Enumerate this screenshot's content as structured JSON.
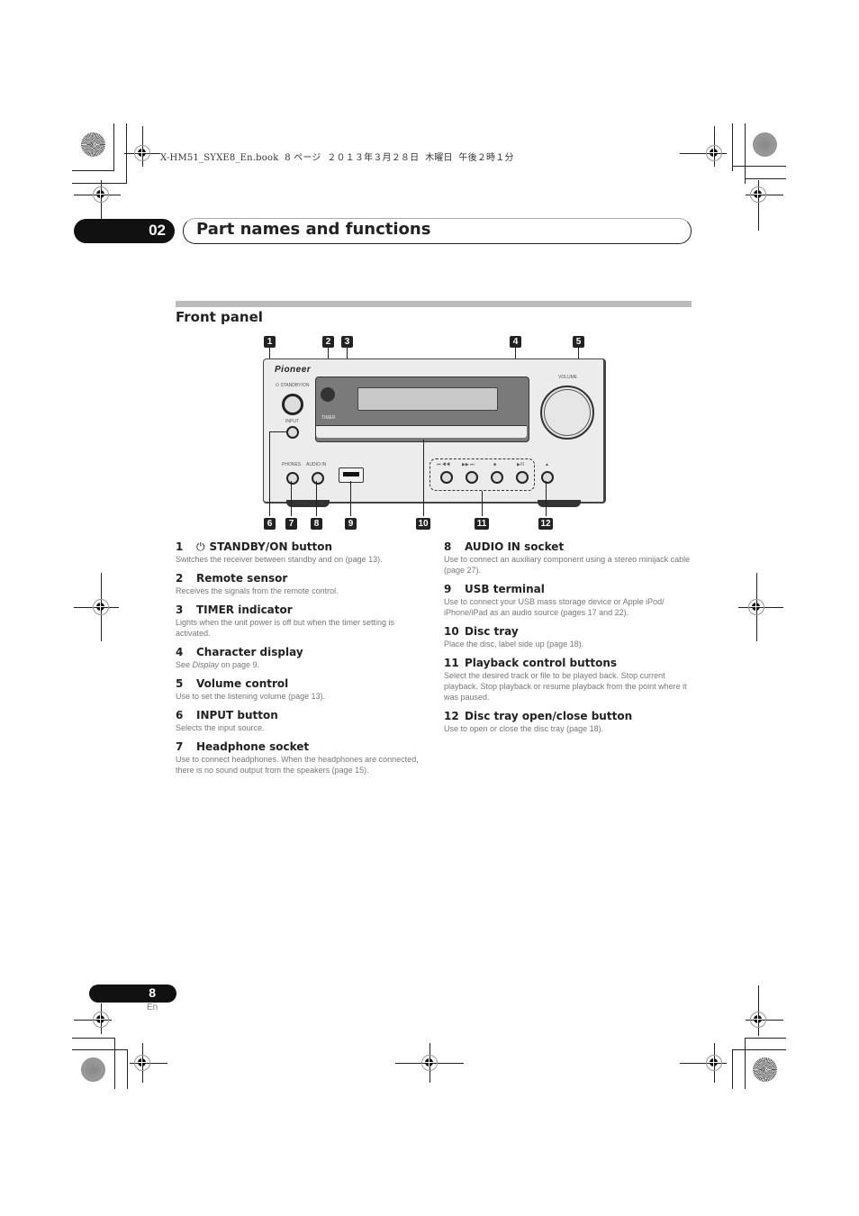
{
  "print_info": "X-HM51_SYXE8_En.book  8 ページ  ２０１３年３月２８日  木曜日  午後２時１分",
  "chapter": {
    "number": "02",
    "title": "Part names and functions"
  },
  "section": {
    "title": "Front panel"
  },
  "diagram": {
    "brand": "Pioneer",
    "labels": {
      "standby": "⏻ STANDBY/ON",
      "timer": "TIMER",
      "input": "INPUT",
      "volume": "VOLUME",
      "phones": "PHONES",
      "audio_in": "AUDIO IN",
      "prev": "⏮ ◀◀",
      "next": "▶▶ ⏭",
      "stop": "■",
      "play_pause": "▶/II",
      "eject": "▲"
    },
    "callouts": [
      "1",
      "2",
      "3",
      "4",
      "5",
      "6",
      "7",
      "8",
      "9",
      "10",
      "11",
      "12"
    ]
  },
  "items_left": [
    {
      "num": "1",
      "icon": "power-icon",
      "icon_glyph": "⏻",
      "title": "STANDBY/ON button",
      "desc": "Switches the receiver between standby and on (page 13)."
    },
    {
      "num": "2",
      "title": "Remote sensor",
      "desc": "Receives the signals from the remote control."
    },
    {
      "num": "3",
      "title": "TIMER indicator",
      "desc": "Lights when the unit power is off but when the timer setting is activated."
    },
    {
      "num": "4",
      "title": "Character display",
      "desc_prefix": "See ",
      "desc_em": "Display",
      "desc_suffix": " on page 9."
    },
    {
      "num": "5",
      "title": "Volume control",
      "desc": "Use to set the listening volume (page 13)."
    },
    {
      "num": "6",
      "title": "INPUT button",
      "desc": "Selects the input source."
    },
    {
      "num": "7",
      "title": "Headphone socket",
      "desc": "Use to connect headphones. When the headphones are connected, there is no sound output from the speakers (page 15)."
    }
  ],
  "items_right": [
    {
      "num": "8",
      "title": "AUDIO IN socket",
      "desc": "Use to connect an auxiliary component using a stereo minijack cable (page 27)."
    },
    {
      "num": "9",
      "title": "USB terminal",
      "desc": "Use to connect your USB mass storage device or Apple iPod/ iPhone/iPad as an audio source (pages 17 and 22)."
    },
    {
      "num": "10",
      "title": "Disc tray",
      "desc": "Place the disc, label side up (page 18)."
    },
    {
      "num": "11",
      "title": "Playback control buttons",
      "desc": "Select the desired track or file to be played back. Stop current playback. Stop playback or resume playback from the point where it was paused."
    },
    {
      "num": "12",
      "title": "Disc tray open/close button",
      "desc": "Use to open or close the disc tray (page 18)."
    }
  ],
  "footer": {
    "page_number": "8",
    "language": "En"
  }
}
